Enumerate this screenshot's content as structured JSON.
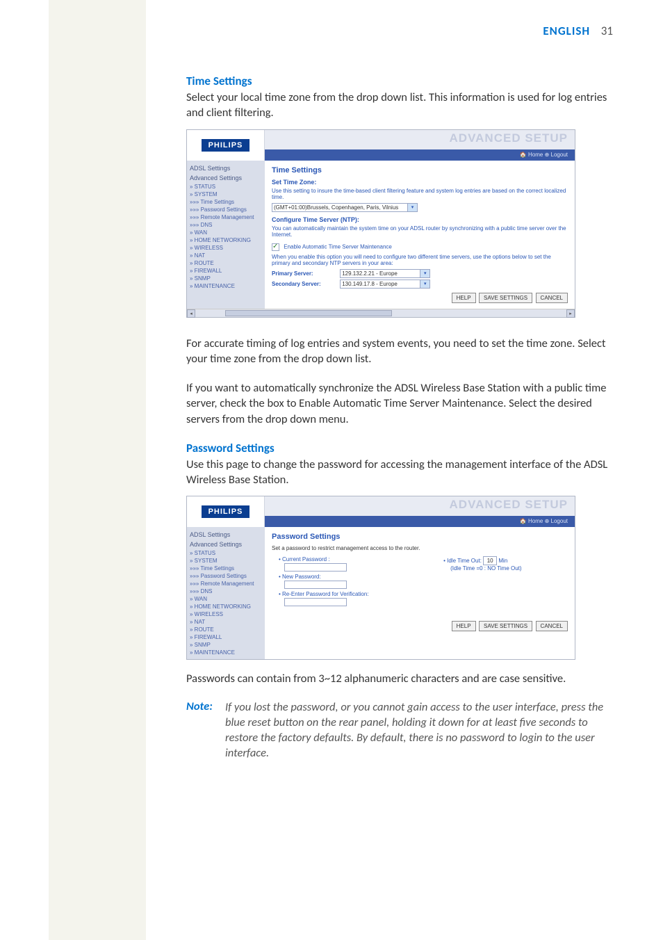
{
  "header": {
    "language": "ENGLISH",
    "page_number": "31"
  },
  "time_section": {
    "heading": "Time Settings",
    "intro": "Select your local time zone from the drop down list. This information is used for log entries and client filtering.",
    "para2": "For accurate timing of log entries and system events, you need to set the time zone. Select your time zone from the drop down list.",
    "para3": "If you want to automatically synchronize the ADSL Wireless Base Station with a public time server, check the box to Enable Automatic Time Server Maintenance. Select the desired servers from the drop down menu."
  },
  "password_section": {
    "heading": "Password Settings",
    "intro": "Use this page to change the password for accessing the management interface of the ADSL Wireless Base Station.",
    "para2": "Passwords can contain from 3~12 alphanumeric characters and are case sensitive."
  },
  "note": {
    "label": "Note:",
    "text": "If you lost the password, or you cannot gain access to the user interface, press the blue reset button on the rear panel, holding it down for at least five seconds to restore the factory defaults. By default, there is no password to login to the user interface."
  },
  "ss_common": {
    "logo": "PHILIPS",
    "banner_title": "ADVANCED SETUP",
    "banner_links": "🏠 Home  ⊕ Logout",
    "sidebar_head1": "ADSL Settings",
    "sidebar_head2": "Advanced Settings",
    "btn_help": "HELP",
    "btn_save": "SAVE SETTINGS",
    "btn_cancel": "CANCEL"
  },
  "ss1": {
    "sidebar": [
      "» STATUS",
      "» SYSTEM",
      "»»» Time Settings",
      "»»» Password Settings",
      "»»» Remote Management",
      "»»» DNS",
      "» WAN",
      "» HOME NETWORKING",
      "» WIRELESS",
      "» NAT",
      "» ROUTE",
      "» FIREWALL",
      "» SNMP",
      "» MAINTENANCE"
    ],
    "title": "Time Settings",
    "set_tz": "Set Time Zone:",
    "tz_desc": "Use this setting to insure the time-based client filtering feature and system log entries are based on the correct localized time.",
    "tz_value": "(GMT+01:00)Brussels, Copenhagen, Paris, Vilnius",
    "ntp_label": "Configure Time Server (NTP):",
    "ntp_desc": "You can automatically maintain the system time on your ADSL router by synchronizing with a public time server over the Internet.",
    "cb_label": "Enable Automatic Time Server Maintenance",
    "ntp_desc2": "When you enable this option you will need to configure two different time servers, use the options below to set the primary and secondary NTP servers in your area:",
    "primary_label": "Primary Server:",
    "primary_value": "129.132.2.21 - Europe",
    "secondary_label": "Secondary Server:",
    "secondary_value": "130.149.17.8 - Europe"
  },
  "ss2": {
    "sidebar": [
      "» STATUS",
      "» SYSTEM",
      "»»» Time Settings",
      "»»» Password Settings",
      "»»» Remote Management",
      "»»» DNS",
      "» WAN",
      "» HOME NETWORKING",
      "» WIRELESS",
      "» NAT",
      "» ROUTE",
      "» FIREWALL",
      "» SNMP",
      "» MAINTENANCE"
    ],
    "title": "Password Settings",
    "subtitle": "Set a password to restrict management access to the router.",
    "current_pw": "Current Password :",
    "new_pw": "New Password:",
    "reenter_pw": "Re-Enter Password for Verification:",
    "idle_out": "Idle Time Out:",
    "idle_value": "10",
    "idle_unit": "Min",
    "idle_hint": "(Idle Time =0 : NO Time Out)"
  }
}
